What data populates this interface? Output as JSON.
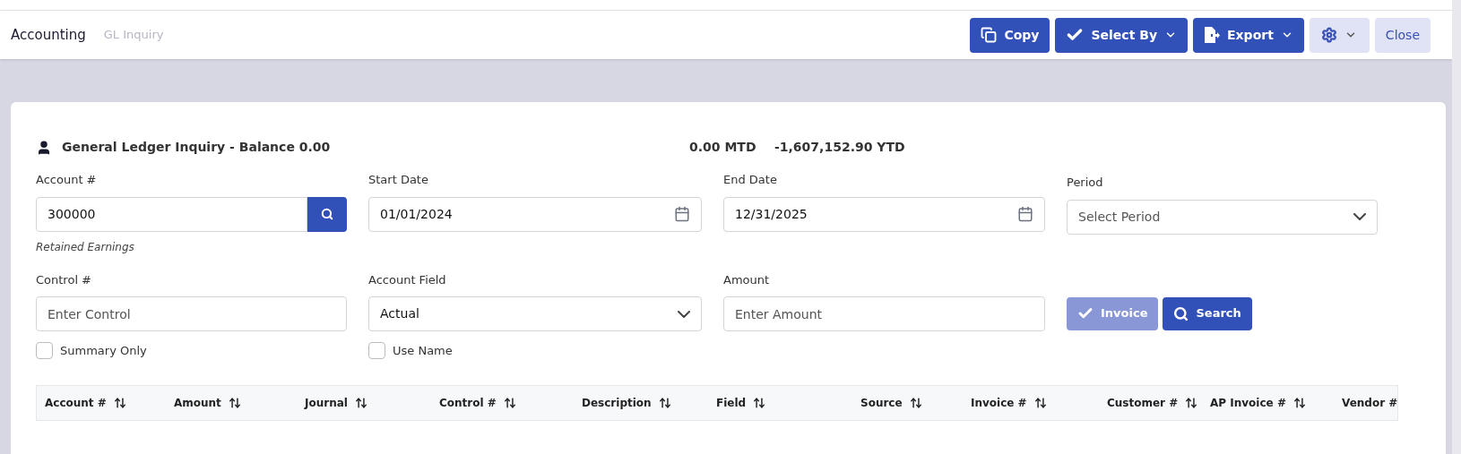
{
  "header": {
    "title": "Accounting",
    "subtitle": "GL Inquiry",
    "buttons": [
      {
        "kind": "copy",
        "label": "Copy",
        "dropdown": false
      },
      {
        "kind": "check",
        "label": "Select By",
        "dropdown": true
      },
      {
        "kind": "export",
        "label": "Export",
        "dropdown": true
      },
      {
        "kind": "gear",
        "dropdown": true
      },
      {
        "kind": "plain",
        "label": "Close",
        "dropdown": false
      }
    ]
  },
  "card": {
    "title": "General Ledger Inquiry - Balance 0.00",
    "mtd": "0.00 MTD",
    "ytd": "-1,607,152.90 YTD",
    "fields": [
      {
        "kind": "search",
        "label": "Account #",
        "value": "300000",
        "note": "Retained Earnings"
      },
      {
        "kind": "date",
        "label": "Start Date",
        "value": "01/01/2024"
      },
      {
        "kind": "date",
        "label": "End Date",
        "value": "12/31/2025"
      },
      {
        "kind": "select",
        "label": "Period",
        "placeholder": "Select Period"
      },
      {
        "kind": "text",
        "label": "Control #",
        "placeholder": "Enter Control",
        "checkbox": {
          "label": "Summary Only",
          "checked": false
        }
      },
      {
        "kind": "select",
        "label": "Account Field",
        "value": "Actual",
        "checkbox": {
          "label": "Use Name",
          "checked": false
        }
      },
      {
        "kind": "text",
        "label": "Amount",
        "placeholder": "Enter Amount"
      }
    ],
    "actions": [
      {
        "kind": "check",
        "label": "Invoice",
        "disabled": true
      },
      {
        "kind": "search",
        "label": "Search",
        "disabled": false
      }
    ]
  },
  "table": {
    "columns": [
      {
        "label": "Account #",
        "sortable": true
      },
      {
        "label": "Amount",
        "sortable": true
      },
      {
        "label": "Journal",
        "sortable": true
      },
      {
        "label": "Control #",
        "sortable": true
      },
      {
        "label": "Description",
        "sortable": true
      },
      {
        "label": "Field",
        "sortable": true
      },
      {
        "label": "Source",
        "sortable": true
      },
      {
        "label": "Invoice #",
        "sortable": true
      },
      {
        "label": "Customer #",
        "sortable": true
      },
      {
        "label": "AP Invoice #",
        "sortable": true
      },
      {
        "label": "Vendor #",
        "sortable": false
      }
    ]
  }
}
